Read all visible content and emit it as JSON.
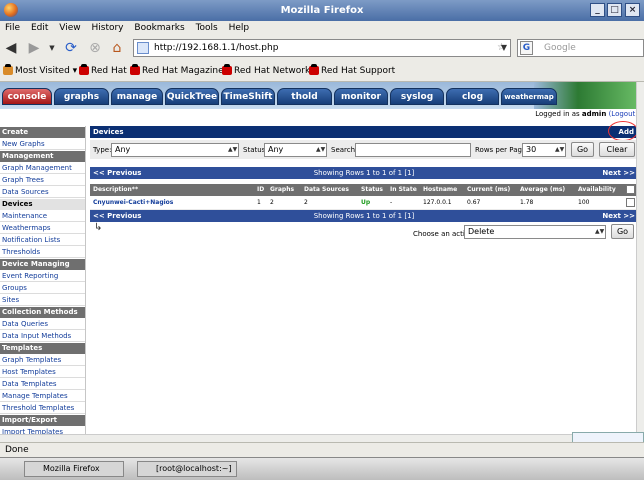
{
  "window": {
    "title": "Mozilla Firefox"
  },
  "menu": [
    "File",
    "Edit",
    "View",
    "History",
    "Bookmarks",
    "Tools",
    "Help"
  ],
  "nav": {
    "url": "http://192.168.1.1/host.php",
    "search_placeholder": "Google"
  },
  "bookmarks": [
    "Most Visited",
    "Red Hat",
    "Red Hat Magazine",
    "Red Hat Network",
    "Red Hat Support"
  ],
  "tabs": [
    "console",
    "graphs",
    "manage",
    "QuickTree",
    "TimeShift",
    "thold",
    "monitor",
    "syslog",
    "clog",
    "weathermap"
  ],
  "login": {
    "prefix": "Logged in as",
    "user": "admin",
    "logout": "(Logout)"
  },
  "sidebar": [
    {
      "type": "header",
      "label": "Create"
    },
    {
      "type": "item",
      "label": "New Graphs"
    },
    {
      "type": "header",
      "label": "Management"
    },
    {
      "type": "item",
      "label": "Graph Management"
    },
    {
      "type": "item",
      "label": "Graph Trees"
    },
    {
      "type": "item",
      "label": "Data Sources"
    },
    {
      "type": "selected",
      "label": "Devices"
    },
    {
      "type": "item",
      "label": "Maintenance"
    },
    {
      "type": "item",
      "label": "Weathermaps"
    },
    {
      "type": "item",
      "label": "Notification Lists"
    },
    {
      "type": "item",
      "label": "Thresholds"
    },
    {
      "type": "header",
      "label": "Device Managing"
    },
    {
      "type": "item",
      "label": "Event Reporting"
    },
    {
      "type": "item",
      "label": "Groups"
    },
    {
      "type": "item",
      "label": "Sites"
    },
    {
      "type": "header",
      "label": "Collection Methods"
    },
    {
      "type": "item",
      "label": "Data Queries"
    },
    {
      "type": "item",
      "label": "Data Input Methods"
    },
    {
      "type": "header",
      "label": "Templates"
    },
    {
      "type": "item",
      "label": "Graph Templates"
    },
    {
      "type": "item",
      "label": "Host Templates"
    },
    {
      "type": "item",
      "label": "Data Templates"
    },
    {
      "type": "item",
      "label": "Manage Templates"
    },
    {
      "type": "item",
      "label": "Threshold Templates"
    },
    {
      "type": "header",
      "label": "Import/Export"
    },
    {
      "type": "item",
      "label": "Import Templates"
    }
  ],
  "devices": {
    "title": "Devices",
    "add": "Add",
    "filter": {
      "type_label": "Type:",
      "type_value": "Any",
      "status_label": "Status:",
      "status_value": "Any",
      "search_label": "Search:",
      "search_value": "",
      "rows_label": "Rows per Page:",
      "rows_value": "30",
      "go": "Go",
      "clear": "Clear"
    },
    "pager": {
      "prev": "<< Previous",
      "showing": "Showing Rows 1 to 1 of 1 [1]",
      "next": "Next >>"
    },
    "columns": [
      "Description**",
      "ID",
      "Graphs",
      "Data Sources",
      "Status",
      "In State",
      "Hostname",
      "Current (ms)",
      "Average (ms)",
      "Availability"
    ],
    "rows": [
      {
        "description": "Cnyunwei-Cacti+Nagios",
        "id": "1",
        "graphs": "2",
        "data_sources": "2",
        "status": "Up",
        "in_state": "-",
        "hostname": "127.0.0.1",
        "current": "0.67",
        "average": "1.78",
        "availability": "100"
      }
    ],
    "action_label": "Choose an action:",
    "action_value": "Delete",
    "action_go": "Go"
  },
  "status": "Done",
  "taskbar": [
    "Mozilla Firefox",
    "[root@localhost:~]"
  ],
  "colors": {
    "tab": "#173e79",
    "header": "#0b2f73",
    "status_up": "#1a9a1a"
  }
}
